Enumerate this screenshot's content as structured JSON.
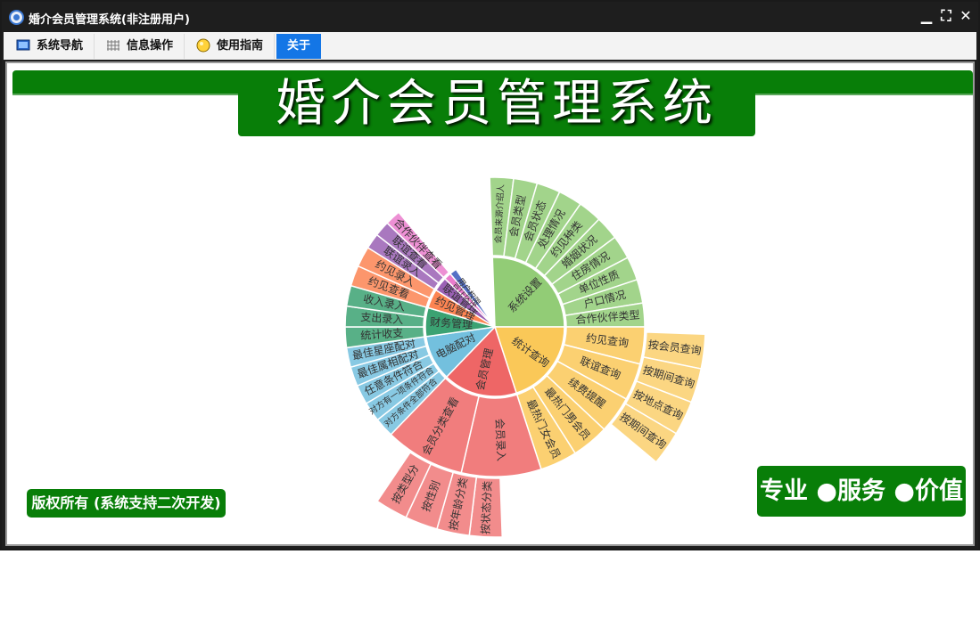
{
  "window": {
    "title": "婚介会员管理系统(非注册用户)",
    "buttons": {
      "minimize": "▁",
      "restore": "⛶",
      "close": "✕"
    }
  },
  "menu": {
    "items": [
      {
        "label": "系统导航",
        "icon": "monitor-icon"
      },
      {
        "label": "信息操作",
        "icon": "grid-icon"
      },
      {
        "label": "使用指南",
        "icon": "bulb-icon"
      },
      {
        "label": "关于",
        "icon": ""
      }
    ],
    "active_index": 3
  },
  "main": {
    "title": "婚介会员管理系统",
    "copyright": "版权所有 (系统支持二次开发)",
    "slogan": "专业 ●服务 ●价值"
  },
  "colors": {
    "brand_green": "#087e08",
    "menu_active": "#1476e6",
    "titlebar": "#1e1e1e"
  },
  "sunburst": {
    "groups": [
      {
        "name": "系统设置",
        "color": "#92cc76",
        "span": 92,
        "children": [
          "会员来源介绍人",
          "会员类型",
          "会员状态",
          "处理情况",
          "约见种类",
          "婚姻状况",
          "住房情况",
          "单位性质",
          "户口情况",
          "合作伙伴类型"
        ],
        "grandchildren": []
      },
      {
        "name": "统计查询",
        "color": "#fac858",
        "span": 72,
        "children": [
          "约见查询",
          "联谊查询",
          "续费提醒",
          "最热门男会员",
          "最热门女会员"
        ],
        "grandchildren": [
          "按会员查询",
          "按期间查询",
          "按地点查询",
          "按期间查询"
        ]
      },
      {
        "name": "会员管理",
        "color": "#ee6666",
        "span": 62,
        "children": [
          "会员录入",
          "会员分类查看"
        ],
        "grandchildren": [
          "按状态分类",
          "按年龄分类",
          "按性别",
          "按类型分"
        ]
      },
      {
        "name": "电脑配对",
        "color": "#73c0de",
        "span": 38,
        "children": [
          "对方条件全部符合",
          "对方有一项条件符合",
          "任意条件符合",
          "最佳属相配对",
          "最佳星座配对"
        ],
        "grandchildren": []
      },
      {
        "name": "财务管理",
        "color": "#3ba272",
        "span": 24,
        "children": [
          "统计收支",
          "支出录入",
          "收入录入"
        ],
        "grandchildren": []
      },
      {
        "name": "约见管理",
        "color": "#fc8452",
        "span": 16,
        "children": [
          "约见查看",
          "约见录入"
        ],
        "grandchildren": []
      },
      {
        "name": "联谊管理",
        "color": "#9a60b4",
        "span": 12,
        "children": [
          "联谊录入",
          "联谊查看"
        ],
        "grandchildren": []
      },
      {
        "name": "合作伙伴",
        "color": "#ea7ccc",
        "span": 6,
        "children": [
          "合作伙伴查看"
        ],
        "grandchildren": []
      },
      {
        "name": "用户权限",
        "color": "#5470c6",
        "span": 6,
        "children": [],
        "grandchildren": []
      }
    ]
  }
}
